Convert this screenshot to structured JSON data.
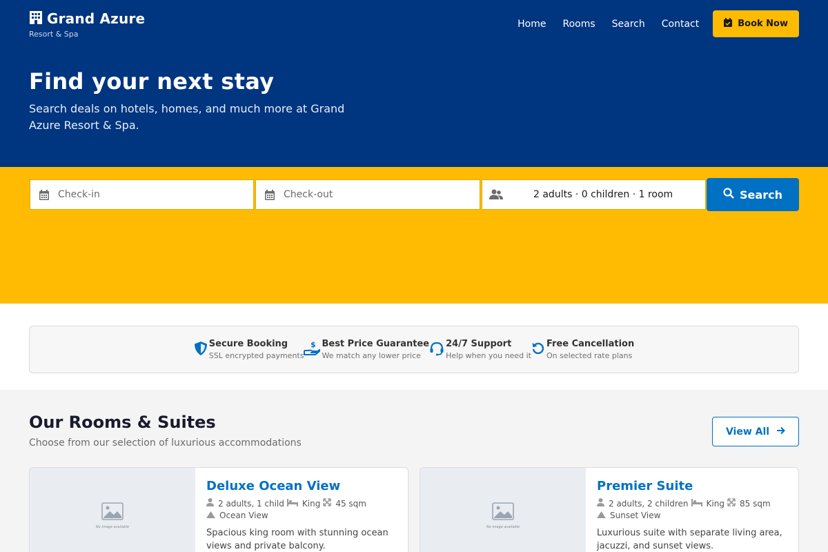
{
  "header": {
    "brand_title": "Grand Azure",
    "brand_sub": "Resort & Spa",
    "nav": [
      "Home",
      "Rooms",
      "Search",
      "Contact"
    ],
    "book_label": "Book Now"
  },
  "hero": {
    "title": "Find your next stay",
    "subtitle": "Search deals on hotels, homes, and much more at Grand Azure Resort & Spa."
  },
  "search": {
    "checkin_placeholder": "Check-in",
    "checkout_placeholder": "Check-out",
    "guests_value": "2 adults · 0 children · 1 room",
    "button_label": "Search"
  },
  "trust": [
    {
      "title": "Secure Booking",
      "sub": "SSL encrypted payments",
      "icon": "shield-icon"
    },
    {
      "title": "Best Price Guarantee",
      "sub": "We match any lower price",
      "icon": "hand-dollar-icon"
    },
    {
      "title": "24/7 Support",
      "sub": "Help when you need it",
      "icon": "headset-icon"
    },
    {
      "title": "Free Cancellation",
      "sub": "On selected rate plans",
      "icon": "undo-icon"
    }
  ],
  "rooms": {
    "title": "Our Rooms & Suites",
    "subtitle": "Choose from our selection of luxurious accommodations",
    "view_all": "View All",
    "no_image": "No image available",
    "cards": [
      {
        "title": "Deluxe Ocean View",
        "guests": "2 adults, 1 child",
        "bed": "King",
        "size": "45 sqm",
        "view": "Ocean View",
        "desc": "Spacious king room with stunning ocean views and private balcony."
      },
      {
        "title": "Premier Suite",
        "guests": "2 adults, 2 children",
        "bed": "King",
        "size": "85 sqm",
        "view": "Sunset View",
        "desc": "Luxurious suite with separate living area, jacuzzi, and sunset views."
      }
    ]
  },
  "colors": {
    "brand_blue": "#003580",
    "accent_yellow": "#febb02",
    "link_blue": "#0071c2"
  }
}
